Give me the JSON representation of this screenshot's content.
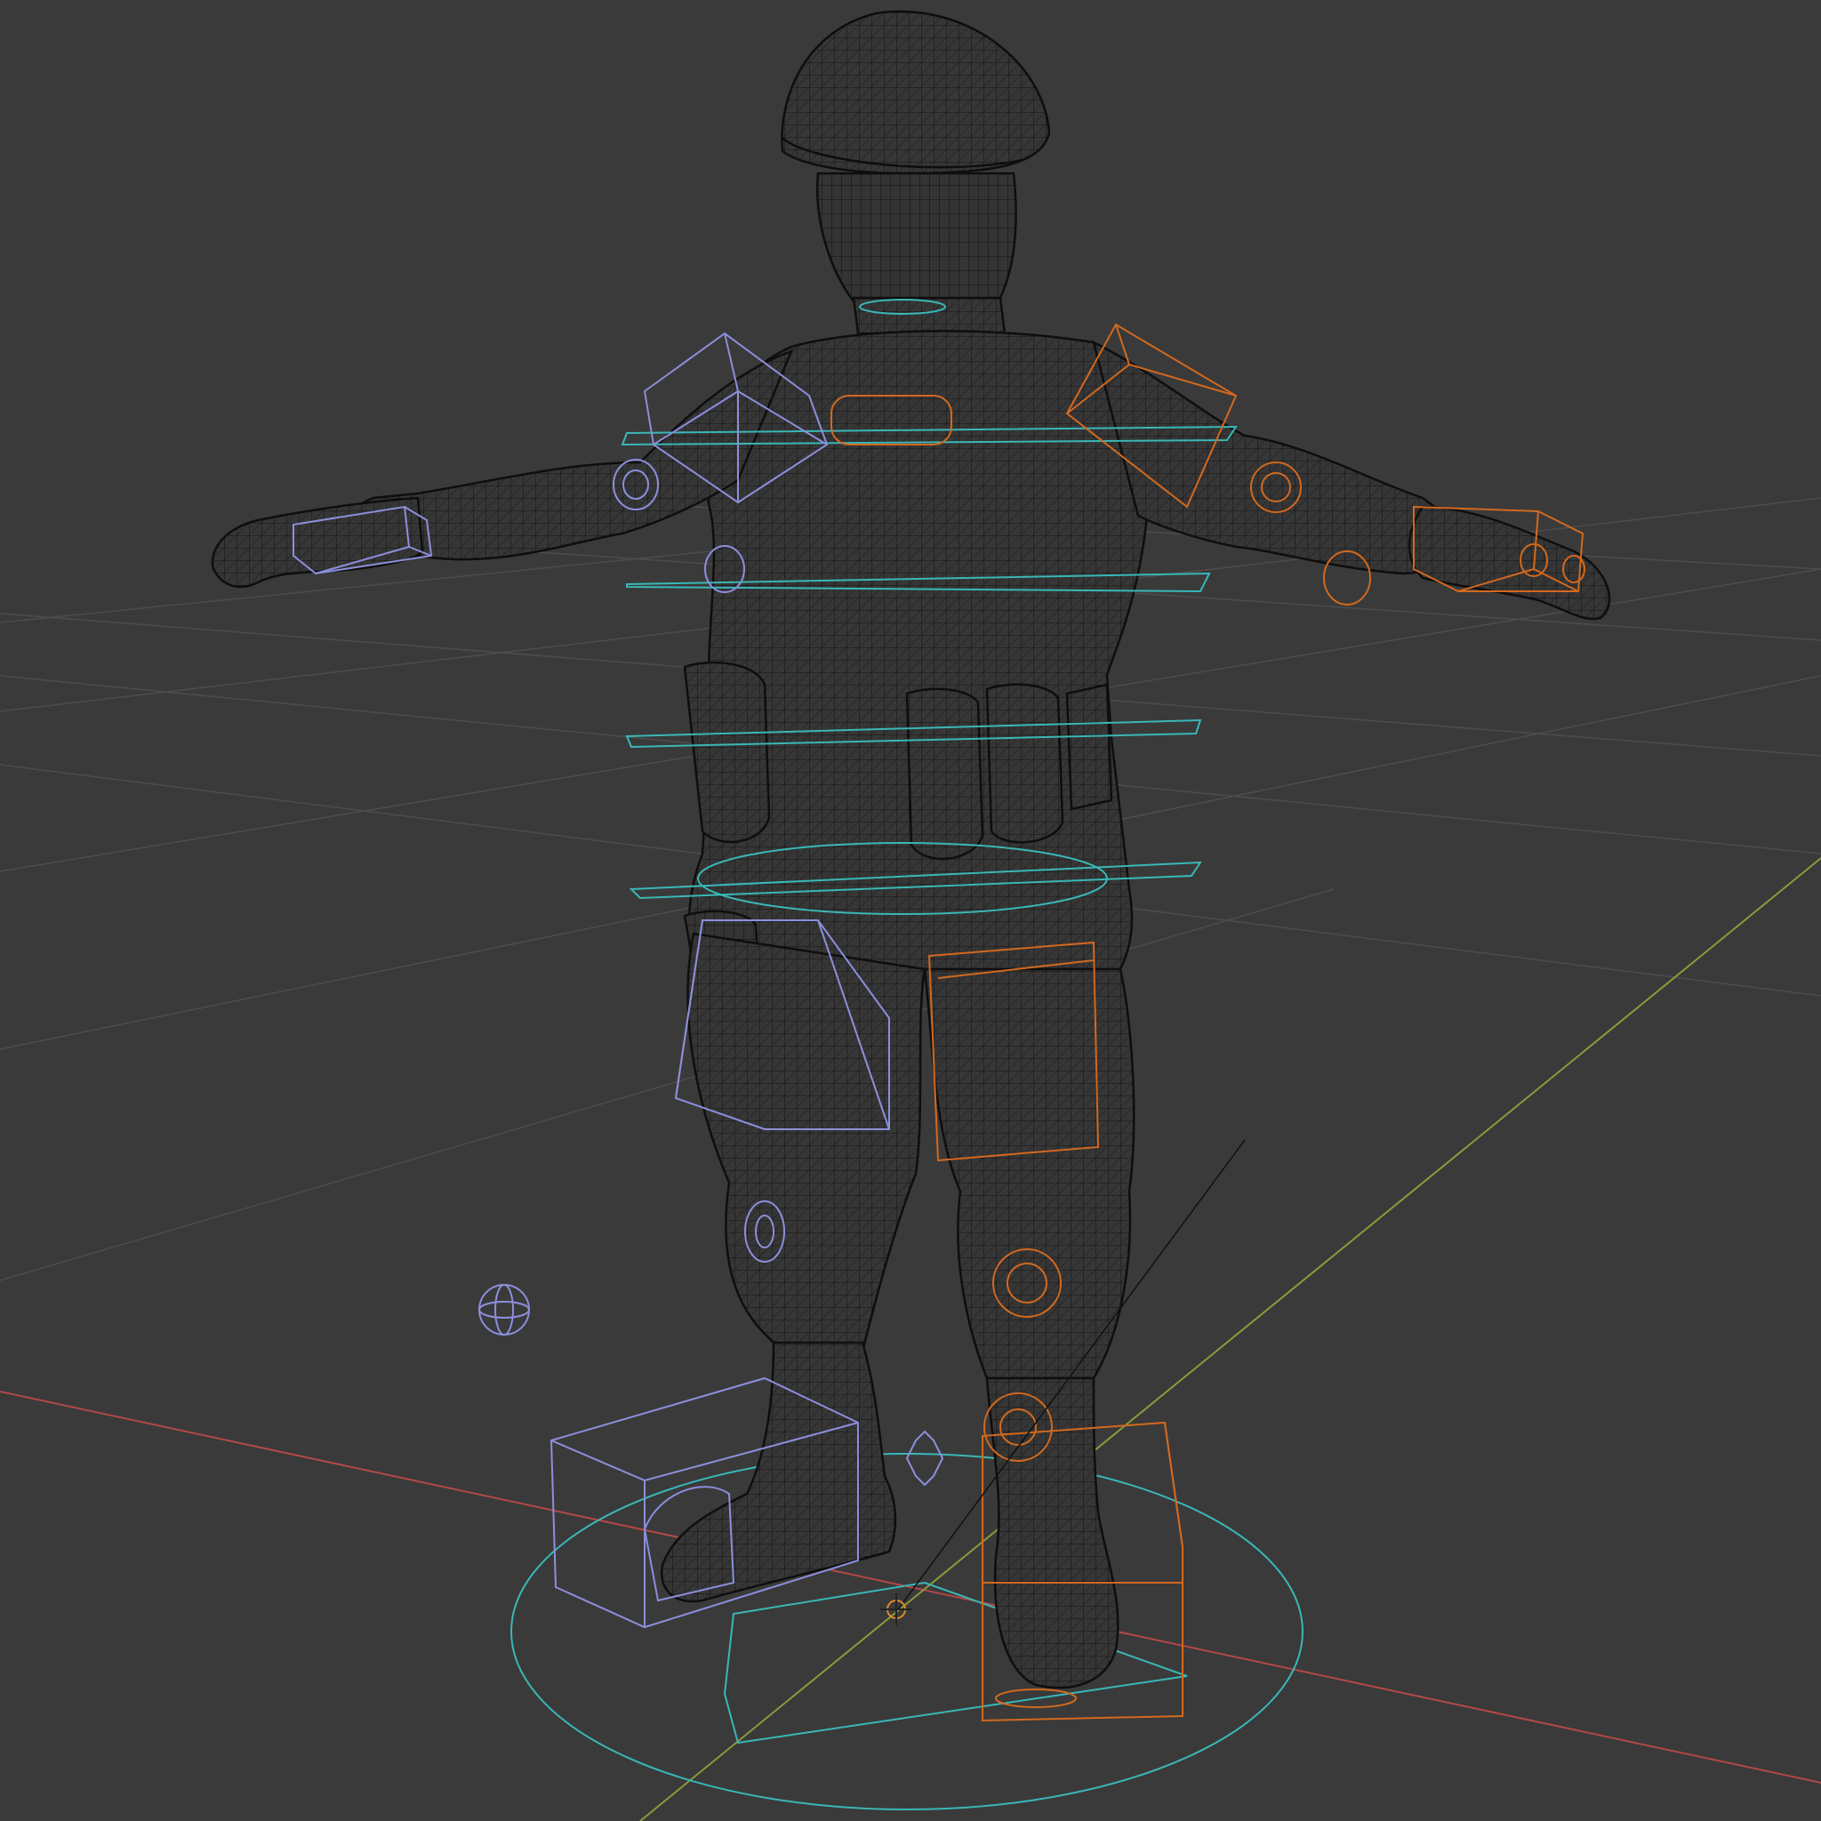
{
  "viewport": {
    "background": "#3a3a3a",
    "view_mode": "wireframe",
    "scene_description_colors": {
      "grid": "#4d4d4d",
      "axis_x": "#b34848",
      "axis_y": "#8a9a3c",
      "mesh_wire": "#111111",
      "mesh_fill": "#373737",
      "controls_left": "#8c8fdc",
      "controls_right": "#d2691e",
      "controls_center": "#3ab7b7",
      "origin_cursor": "#e08a2a"
    }
  },
  "objects": {
    "character": "soldier-mesh",
    "rig": "control-rig"
  }
}
